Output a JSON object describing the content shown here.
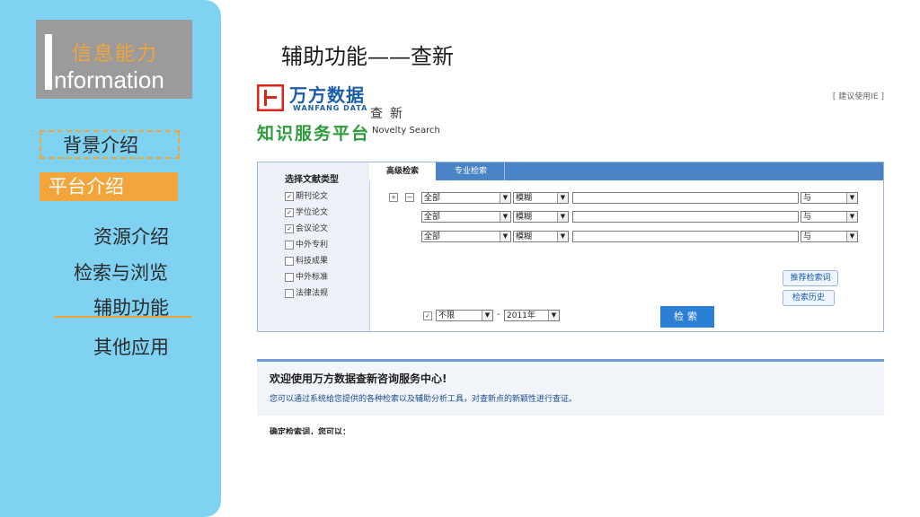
{
  "sidebar": {
    "logo_cn": "信息能力",
    "logo_en": "nformation",
    "items": [
      {
        "label": "背景介绍"
      },
      {
        "label": "平台介绍"
      },
      {
        "label": "资源介绍"
      },
      {
        "label": "检索与浏览"
      },
      {
        "label": "辅助功能"
      },
      {
        "label": "其他应用"
      }
    ]
  },
  "slide": {
    "title": "辅助功能——查新"
  },
  "screenshot": {
    "brand": "万方数据",
    "brand_en": "WANFANG DATA",
    "check_label": "查新",
    "knowledge_platform": "知识服务平台",
    "novelty": "Novelty Search",
    "ie_hint": "[ 建议使用IE ]",
    "doc_type_title": "选择文献类型",
    "doc_types": [
      {
        "label": "期刊论文",
        "checked": true
      },
      {
        "label": "学位论文",
        "checked": true
      },
      {
        "label": "会议论文",
        "checked": true
      },
      {
        "label": "中外专利",
        "checked": false
      },
      {
        "label": "科技成果",
        "checked": false
      },
      {
        "label": "中外标准",
        "checked": false
      },
      {
        "label": "法律法规",
        "checked": false
      }
    ],
    "tabs": [
      "高级检索",
      "专业检索"
    ],
    "rows": [
      {
        "field": "全部",
        "match": "模糊",
        "logic": "与"
      },
      {
        "field": "全部",
        "match": "模糊",
        "logic": "与"
      },
      {
        "field": "全部",
        "match": "模糊",
        "logic": "与"
      }
    ],
    "plus": "+",
    "minus": "−",
    "recommend_btn": "推荐检索词",
    "history_btn": "检索历史",
    "year_from": "不限",
    "year_sep": "-",
    "year_to": "2011年",
    "search_btn": "检索",
    "welcome_title": "欢迎使用万方数据查新咨询服务中心!",
    "welcome_sub": "您可以通过系统给您提供的各种检索以及辅助分析工具，对查新点的新颖性进行查证。",
    "cutoff": "确定检索词，您可以："
  }
}
